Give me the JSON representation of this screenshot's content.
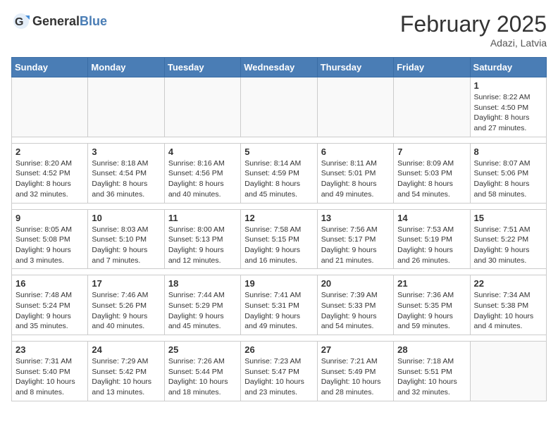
{
  "header": {
    "logo_general": "General",
    "logo_blue": "Blue",
    "month_title": "February 2025",
    "location": "Adazi, Latvia"
  },
  "days_of_week": [
    "Sunday",
    "Monday",
    "Tuesday",
    "Wednesday",
    "Thursday",
    "Friday",
    "Saturday"
  ],
  "weeks": [
    [
      {
        "day": "",
        "info": ""
      },
      {
        "day": "",
        "info": ""
      },
      {
        "day": "",
        "info": ""
      },
      {
        "day": "",
        "info": ""
      },
      {
        "day": "",
        "info": ""
      },
      {
        "day": "",
        "info": ""
      },
      {
        "day": "1",
        "info": "Sunrise: 8:22 AM\nSunset: 4:50 PM\nDaylight: 8 hours and 27 minutes."
      }
    ],
    [
      {
        "day": "2",
        "info": "Sunrise: 8:20 AM\nSunset: 4:52 PM\nDaylight: 8 hours and 32 minutes."
      },
      {
        "day": "3",
        "info": "Sunrise: 8:18 AM\nSunset: 4:54 PM\nDaylight: 8 hours and 36 minutes."
      },
      {
        "day": "4",
        "info": "Sunrise: 8:16 AM\nSunset: 4:56 PM\nDaylight: 8 hours and 40 minutes."
      },
      {
        "day": "5",
        "info": "Sunrise: 8:14 AM\nSunset: 4:59 PM\nDaylight: 8 hours and 45 minutes."
      },
      {
        "day": "6",
        "info": "Sunrise: 8:11 AM\nSunset: 5:01 PM\nDaylight: 8 hours and 49 minutes."
      },
      {
        "day": "7",
        "info": "Sunrise: 8:09 AM\nSunset: 5:03 PM\nDaylight: 8 hours and 54 minutes."
      },
      {
        "day": "8",
        "info": "Sunrise: 8:07 AM\nSunset: 5:06 PM\nDaylight: 8 hours and 58 minutes."
      }
    ],
    [
      {
        "day": "9",
        "info": "Sunrise: 8:05 AM\nSunset: 5:08 PM\nDaylight: 9 hours and 3 minutes."
      },
      {
        "day": "10",
        "info": "Sunrise: 8:03 AM\nSunset: 5:10 PM\nDaylight: 9 hours and 7 minutes."
      },
      {
        "day": "11",
        "info": "Sunrise: 8:00 AM\nSunset: 5:13 PM\nDaylight: 9 hours and 12 minutes."
      },
      {
        "day": "12",
        "info": "Sunrise: 7:58 AM\nSunset: 5:15 PM\nDaylight: 9 hours and 16 minutes."
      },
      {
        "day": "13",
        "info": "Sunrise: 7:56 AM\nSunset: 5:17 PM\nDaylight: 9 hours and 21 minutes."
      },
      {
        "day": "14",
        "info": "Sunrise: 7:53 AM\nSunset: 5:19 PM\nDaylight: 9 hours and 26 minutes."
      },
      {
        "day": "15",
        "info": "Sunrise: 7:51 AM\nSunset: 5:22 PM\nDaylight: 9 hours and 30 minutes."
      }
    ],
    [
      {
        "day": "16",
        "info": "Sunrise: 7:48 AM\nSunset: 5:24 PM\nDaylight: 9 hours and 35 minutes."
      },
      {
        "day": "17",
        "info": "Sunrise: 7:46 AM\nSunset: 5:26 PM\nDaylight: 9 hours and 40 minutes."
      },
      {
        "day": "18",
        "info": "Sunrise: 7:44 AM\nSunset: 5:29 PM\nDaylight: 9 hours and 45 minutes."
      },
      {
        "day": "19",
        "info": "Sunrise: 7:41 AM\nSunset: 5:31 PM\nDaylight: 9 hours and 49 minutes."
      },
      {
        "day": "20",
        "info": "Sunrise: 7:39 AM\nSunset: 5:33 PM\nDaylight: 9 hours and 54 minutes."
      },
      {
        "day": "21",
        "info": "Sunrise: 7:36 AM\nSunset: 5:35 PM\nDaylight: 9 hours and 59 minutes."
      },
      {
        "day": "22",
        "info": "Sunrise: 7:34 AM\nSunset: 5:38 PM\nDaylight: 10 hours and 4 minutes."
      }
    ],
    [
      {
        "day": "23",
        "info": "Sunrise: 7:31 AM\nSunset: 5:40 PM\nDaylight: 10 hours and 8 minutes."
      },
      {
        "day": "24",
        "info": "Sunrise: 7:29 AM\nSunset: 5:42 PM\nDaylight: 10 hours and 13 minutes."
      },
      {
        "day": "25",
        "info": "Sunrise: 7:26 AM\nSunset: 5:44 PM\nDaylight: 10 hours and 18 minutes."
      },
      {
        "day": "26",
        "info": "Sunrise: 7:23 AM\nSunset: 5:47 PM\nDaylight: 10 hours and 23 minutes."
      },
      {
        "day": "27",
        "info": "Sunrise: 7:21 AM\nSunset: 5:49 PM\nDaylight: 10 hours and 28 minutes."
      },
      {
        "day": "28",
        "info": "Sunrise: 7:18 AM\nSunset: 5:51 PM\nDaylight: 10 hours and 32 minutes."
      },
      {
        "day": "",
        "info": ""
      }
    ]
  ]
}
